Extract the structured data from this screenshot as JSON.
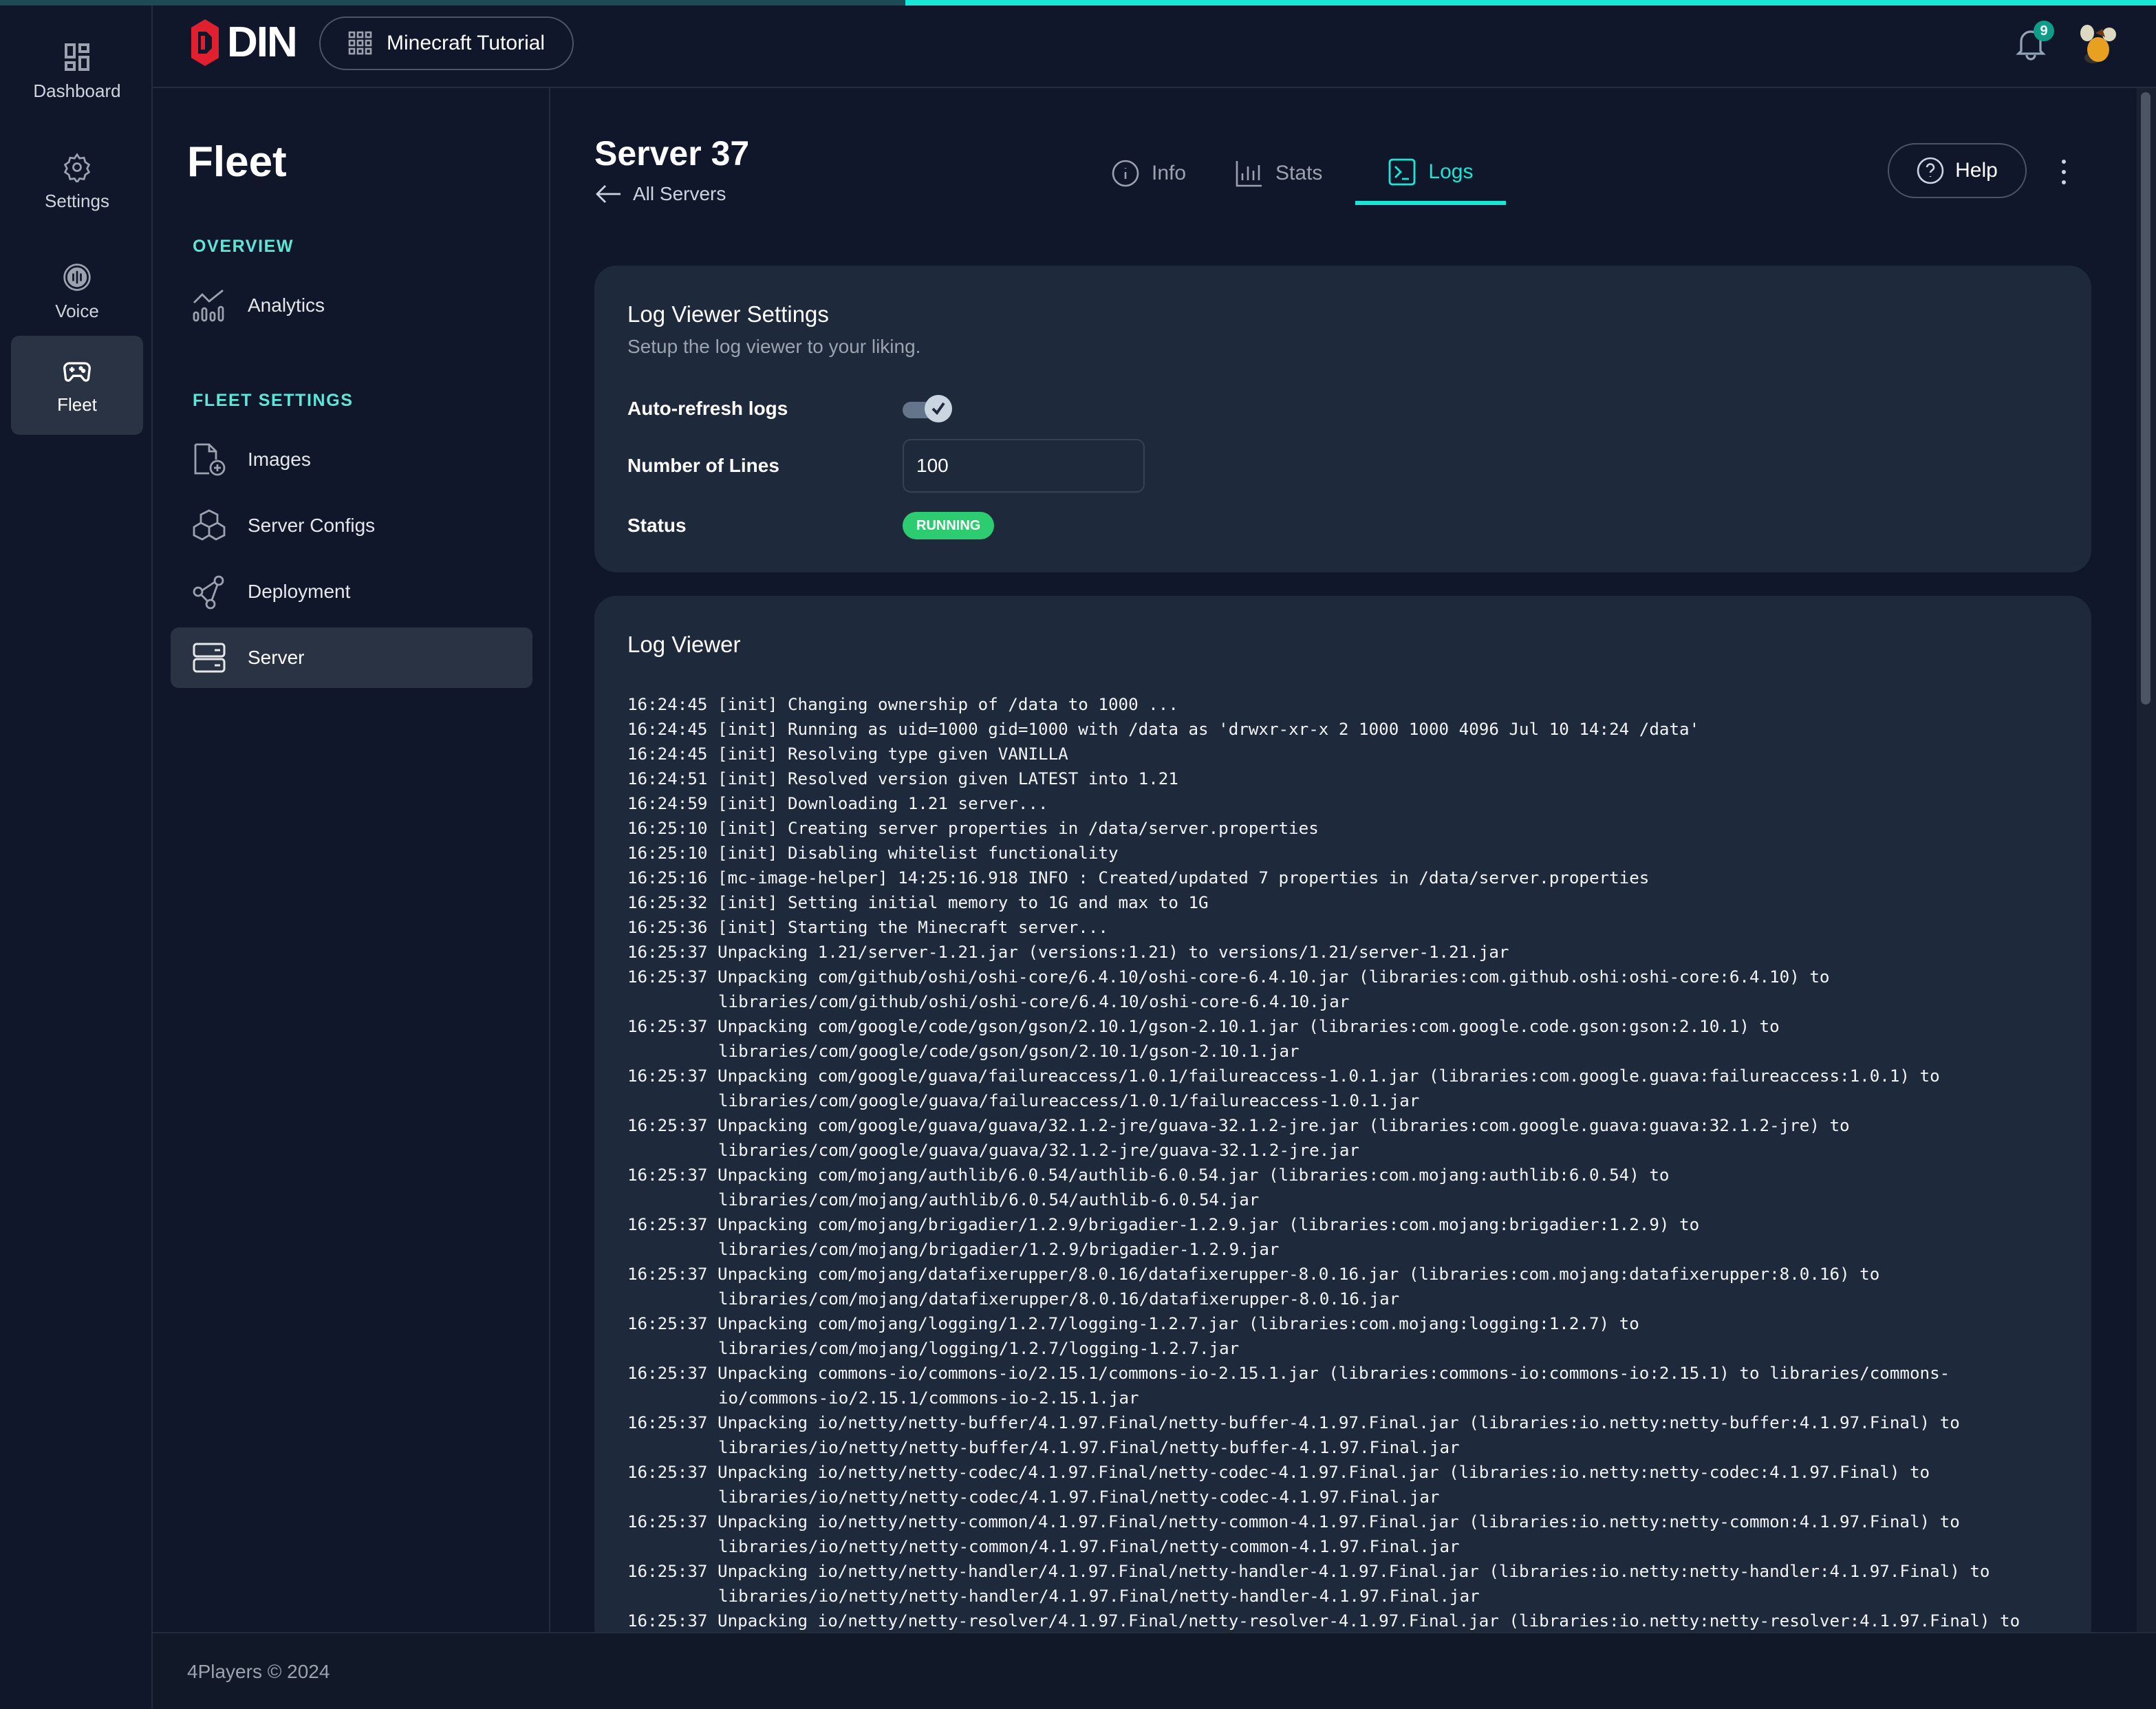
{
  "progress": {
    "percent": 58
  },
  "rail": {
    "items": [
      {
        "label": "Dashboard",
        "icon": "dashboard-icon"
      },
      {
        "label": "Settings",
        "icon": "gear-icon"
      },
      {
        "label": "Voice",
        "icon": "voice-icon"
      },
      {
        "label": "Fleet",
        "icon": "gamepad-icon",
        "active": true
      }
    ]
  },
  "topbar": {
    "logo": "ODIN",
    "logo_text": "DIN",
    "project": "Minecraft Tutorial",
    "notifications": "9"
  },
  "subnav": {
    "title": "Fleet",
    "overview_heading": "OVERVIEW",
    "settings_heading": "FLEET SETTINGS",
    "items": [
      {
        "label": "Analytics",
        "icon": "analytics-icon"
      },
      {
        "label": "Images",
        "icon": "image-file-icon"
      },
      {
        "label": "Server Configs",
        "icon": "boxes-icon"
      },
      {
        "label": "Deployment",
        "icon": "share-nodes-icon"
      },
      {
        "label": "Server",
        "icon": "server-icon",
        "active": true
      }
    ]
  },
  "header": {
    "title": "Server 37",
    "back": "All Servers",
    "help": "Help",
    "tabs": [
      {
        "label": "Info"
      },
      {
        "label": "Stats"
      },
      {
        "label": "Logs",
        "active": true
      }
    ]
  },
  "settings": {
    "title": "Log Viewer Settings",
    "subtitle": "Setup the log viewer to your liking.",
    "auto_refresh_label": "Auto-refresh logs",
    "auto_refresh": true,
    "lines_label": "Number of Lines",
    "lines_value": "100",
    "status_label": "Status",
    "status": "RUNNING",
    "status_color": "#2ecc71"
  },
  "log_viewer": {
    "title": "Log Viewer",
    "lines": [
      "16:24:45 [init] Changing ownership of /data to 1000 ...",
      "16:24:45 [init] Running as uid=1000 gid=1000 with /data as 'drwxr-xr-x 2 1000 1000 4096 Jul 10 14:24 /data'",
      "16:24:45 [init] Resolving type given VANILLA",
      "16:24:51 [init] Resolved version given LATEST into 1.21",
      "16:24:59 [init] Downloading 1.21 server...",
      "16:25:10 [init] Creating server properties in /data/server.properties",
      "16:25:10 [init] Disabling whitelist functionality",
      "16:25:16 [mc-image-helper] 14:25:16.918 INFO : Created/updated 7 properties in /data/server.properties",
      "16:25:32 [init] Setting initial memory to 1G and max to 1G",
      "16:25:36 [init] Starting the Minecraft server...",
      "16:25:37 Unpacking 1.21/server-1.21.jar (versions:1.21) to versions/1.21/server-1.21.jar",
      "16:25:37 Unpacking com/github/oshi/oshi-core/6.4.10/oshi-core-6.4.10.jar (libraries:com.github.oshi:oshi-core:6.4.10) to libraries/com/github/oshi/oshi-core/6.4.10/oshi-core-6.4.10.jar",
      "16:25:37 Unpacking com/google/code/gson/gson/2.10.1/gson-2.10.1.jar (libraries:com.google.code.gson:gson:2.10.1) to libraries/com/google/code/gson/gson/2.10.1/gson-2.10.1.jar",
      "16:25:37 Unpacking com/google/guava/failureaccess/1.0.1/failureaccess-1.0.1.jar (libraries:com.google.guava:failureaccess:1.0.1) to libraries/com/google/guava/failureaccess/1.0.1/failureaccess-1.0.1.jar",
      "16:25:37 Unpacking com/google/guava/guava/32.1.2-jre/guava-32.1.2-jre.jar (libraries:com.google.guava:guava:32.1.2-jre) to libraries/com/google/guava/guava/32.1.2-jre/guava-32.1.2-jre.jar",
      "16:25:37 Unpacking com/mojang/authlib/6.0.54/authlib-6.0.54.jar (libraries:com.mojang:authlib:6.0.54) to libraries/com/mojang/authlib/6.0.54/authlib-6.0.54.jar",
      "16:25:37 Unpacking com/mojang/brigadier/1.2.9/brigadier-1.2.9.jar (libraries:com.mojang:brigadier:1.2.9) to libraries/com/mojang/brigadier/1.2.9/brigadier-1.2.9.jar",
      "16:25:37 Unpacking com/mojang/datafixerupper/8.0.16/datafixerupper-8.0.16.jar (libraries:com.mojang:datafixerupper:8.0.16) to libraries/com/mojang/datafixerupper/8.0.16/datafixerupper-8.0.16.jar",
      "16:25:37 Unpacking com/mojang/logging/1.2.7/logging-1.2.7.jar (libraries:com.mojang:logging:1.2.7) to libraries/com/mojang/logging/1.2.7/logging-1.2.7.jar",
      "16:25:37 Unpacking commons-io/commons-io/2.15.1/commons-io-2.15.1.jar (libraries:commons-io:commons-io:2.15.1) to libraries/commons-io/commons-io/2.15.1/commons-io-2.15.1.jar",
      "16:25:37 Unpacking io/netty/netty-buffer/4.1.97.Final/netty-buffer-4.1.97.Final.jar (libraries:io.netty:netty-buffer:4.1.97.Final) to libraries/io/netty/netty-buffer/4.1.97.Final/netty-buffer-4.1.97.Final.jar",
      "16:25:37 Unpacking io/netty/netty-codec/4.1.97.Final/netty-codec-4.1.97.Final.jar (libraries:io.netty:netty-codec:4.1.97.Final) to libraries/io/netty/netty-codec/4.1.97.Final/netty-codec-4.1.97.Final.jar",
      "16:25:37 Unpacking io/netty/netty-common/4.1.97.Final/netty-common-4.1.97.Final.jar (libraries:io.netty:netty-common:4.1.97.Final) to libraries/io/netty/netty-common/4.1.97.Final/netty-common-4.1.97.Final.jar",
      "16:25:37 Unpacking io/netty/netty-handler/4.1.97.Final/netty-handler-4.1.97.Final.jar (libraries:io.netty:netty-handler:4.1.97.Final) to libraries/io/netty/netty-handler/4.1.97.Final/netty-handler-4.1.97.Final.jar",
      "16:25:37 Unpacking io/netty/netty-resolver/4.1.97.Final/netty-resolver-4.1.97.Final.jar (libraries:io.netty:netty-resolver:4.1.97.Final) to"
    ]
  },
  "footer": {
    "text": "4Players © 2024"
  },
  "colors": {
    "accent": "#19e6d6",
    "heading": "#5ee6d8",
    "brand_red": "#e0202e",
    "background": "#10172a",
    "card": "#1e293b"
  }
}
